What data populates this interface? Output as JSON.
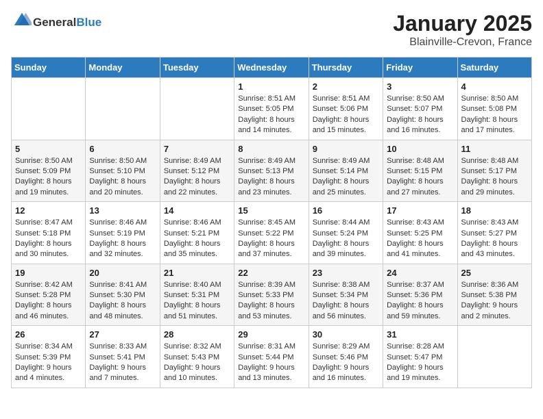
{
  "header": {
    "logo_general": "General",
    "logo_blue": "Blue",
    "month": "January 2025",
    "location": "Blainville-Crevon, France"
  },
  "weekdays": [
    "Sunday",
    "Monday",
    "Tuesday",
    "Wednesday",
    "Thursday",
    "Friday",
    "Saturday"
  ],
  "weeks": [
    [
      {
        "day": "",
        "sunrise": "",
        "sunset": "",
        "daylight": ""
      },
      {
        "day": "",
        "sunrise": "",
        "sunset": "",
        "daylight": ""
      },
      {
        "day": "",
        "sunrise": "",
        "sunset": "",
        "daylight": ""
      },
      {
        "day": "1",
        "sunrise": "Sunrise: 8:51 AM",
        "sunset": "Sunset: 5:05 PM",
        "daylight": "Daylight: 8 hours and 14 minutes."
      },
      {
        "day": "2",
        "sunrise": "Sunrise: 8:51 AM",
        "sunset": "Sunset: 5:06 PM",
        "daylight": "Daylight: 8 hours and 15 minutes."
      },
      {
        "day": "3",
        "sunrise": "Sunrise: 8:50 AM",
        "sunset": "Sunset: 5:07 PM",
        "daylight": "Daylight: 8 hours and 16 minutes."
      },
      {
        "day": "4",
        "sunrise": "Sunrise: 8:50 AM",
        "sunset": "Sunset: 5:08 PM",
        "daylight": "Daylight: 8 hours and 17 minutes."
      }
    ],
    [
      {
        "day": "5",
        "sunrise": "Sunrise: 8:50 AM",
        "sunset": "Sunset: 5:09 PM",
        "daylight": "Daylight: 8 hours and 19 minutes."
      },
      {
        "day": "6",
        "sunrise": "Sunrise: 8:50 AM",
        "sunset": "Sunset: 5:10 PM",
        "daylight": "Daylight: 8 hours and 20 minutes."
      },
      {
        "day": "7",
        "sunrise": "Sunrise: 8:49 AM",
        "sunset": "Sunset: 5:12 PM",
        "daylight": "Daylight: 8 hours and 22 minutes."
      },
      {
        "day": "8",
        "sunrise": "Sunrise: 8:49 AM",
        "sunset": "Sunset: 5:13 PM",
        "daylight": "Daylight: 8 hours and 23 minutes."
      },
      {
        "day": "9",
        "sunrise": "Sunrise: 8:49 AM",
        "sunset": "Sunset: 5:14 PM",
        "daylight": "Daylight: 8 hours and 25 minutes."
      },
      {
        "day": "10",
        "sunrise": "Sunrise: 8:48 AM",
        "sunset": "Sunset: 5:15 PM",
        "daylight": "Daylight: 8 hours and 27 minutes."
      },
      {
        "day": "11",
        "sunrise": "Sunrise: 8:48 AM",
        "sunset": "Sunset: 5:17 PM",
        "daylight": "Daylight: 8 hours and 29 minutes."
      }
    ],
    [
      {
        "day": "12",
        "sunrise": "Sunrise: 8:47 AM",
        "sunset": "Sunset: 5:18 PM",
        "daylight": "Daylight: 8 hours and 30 minutes."
      },
      {
        "day": "13",
        "sunrise": "Sunrise: 8:46 AM",
        "sunset": "Sunset: 5:19 PM",
        "daylight": "Daylight: 8 hours and 32 minutes."
      },
      {
        "day": "14",
        "sunrise": "Sunrise: 8:46 AM",
        "sunset": "Sunset: 5:21 PM",
        "daylight": "Daylight: 8 hours and 35 minutes."
      },
      {
        "day": "15",
        "sunrise": "Sunrise: 8:45 AM",
        "sunset": "Sunset: 5:22 PM",
        "daylight": "Daylight: 8 hours and 37 minutes."
      },
      {
        "day": "16",
        "sunrise": "Sunrise: 8:44 AM",
        "sunset": "Sunset: 5:24 PM",
        "daylight": "Daylight: 8 hours and 39 minutes."
      },
      {
        "day": "17",
        "sunrise": "Sunrise: 8:43 AM",
        "sunset": "Sunset: 5:25 PM",
        "daylight": "Daylight: 8 hours and 41 minutes."
      },
      {
        "day": "18",
        "sunrise": "Sunrise: 8:43 AM",
        "sunset": "Sunset: 5:27 PM",
        "daylight": "Daylight: 8 hours and 43 minutes."
      }
    ],
    [
      {
        "day": "19",
        "sunrise": "Sunrise: 8:42 AM",
        "sunset": "Sunset: 5:28 PM",
        "daylight": "Daylight: 8 hours and 46 minutes."
      },
      {
        "day": "20",
        "sunrise": "Sunrise: 8:41 AM",
        "sunset": "Sunset: 5:30 PM",
        "daylight": "Daylight: 8 hours and 48 minutes."
      },
      {
        "day": "21",
        "sunrise": "Sunrise: 8:40 AM",
        "sunset": "Sunset: 5:31 PM",
        "daylight": "Daylight: 8 hours and 51 minutes."
      },
      {
        "day": "22",
        "sunrise": "Sunrise: 8:39 AM",
        "sunset": "Sunset: 5:33 PM",
        "daylight": "Daylight: 8 hours and 53 minutes."
      },
      {
        "day": "23",
        "sunrise": "Sunrise: 8:38 AM",
        "sunset": "Sunset: 5:34 PM",
        "daylight": "Daylight: 8 hours and 56 minutes."
      },
      {
        "day": "24",
        "sunrise": "Sunrise: 8:37 AM",
        "sunset": "Sunset: 5:36 PM",
        "daylight": "Daylight: 8 hours and 59 minutes."
      },
      {
        "day": "25",
        "sunrise": "Sunrise: 8:36 AM",
        "sunset": "Sunset: 5:38 PM",
        "daylight": "Daylight: 9 hours and 2 minutes."
      }
    ],
    [
      {
        "day": "26",
        "sunrise": "Sunrise: 8:34 AM",
        "sunset": "Sunset: 5:39 PM",
        "daylight": "Daylight: 9 hours and 4 minutes."
      },
      {
        "day": "27",
        "sunrise": "Sunrise: 8:33 AM",
        "sunset": "Sunset: 5:41 PM",
        "daylight": "Daylight: 9 hours and 7 minutes."
      },
      {
        "day": "28",
        "sunrise": "Sunrise: 8:32 AM",
        "sunset": "Sunset: 5:43 PM",
        "daylight": "Daylight: 9 hours and 10 minutes."
      },
      {
        "day": "29",
        "sunrise": "Sunrise: 8:31 AM",
        "sunset": "Sunset: 5:44 PM",
        "daylight": "Daylight: 9 hours and 13 minutes."
      },
      {
        "day": "30",
        "sunrise": "Sunrise: 8:29 AM",
        "sunset": "Sunset: 5:46 PM",
        "daylight": "Daylight: 9 hours and 16 minutes."
      },
      {
        "day": "31",
        "sunrise": "Sunrise: 8:28 AM",
        "sunset": "Sunset: 5:47 PM",
        "daylight": "Daylight: 9 hours and 19 minutes."
      },
      {
        "day": "",
        "sunrise": "",
        "sunset": "",
        "daylight": ""
      }
    ]
  ]
}
